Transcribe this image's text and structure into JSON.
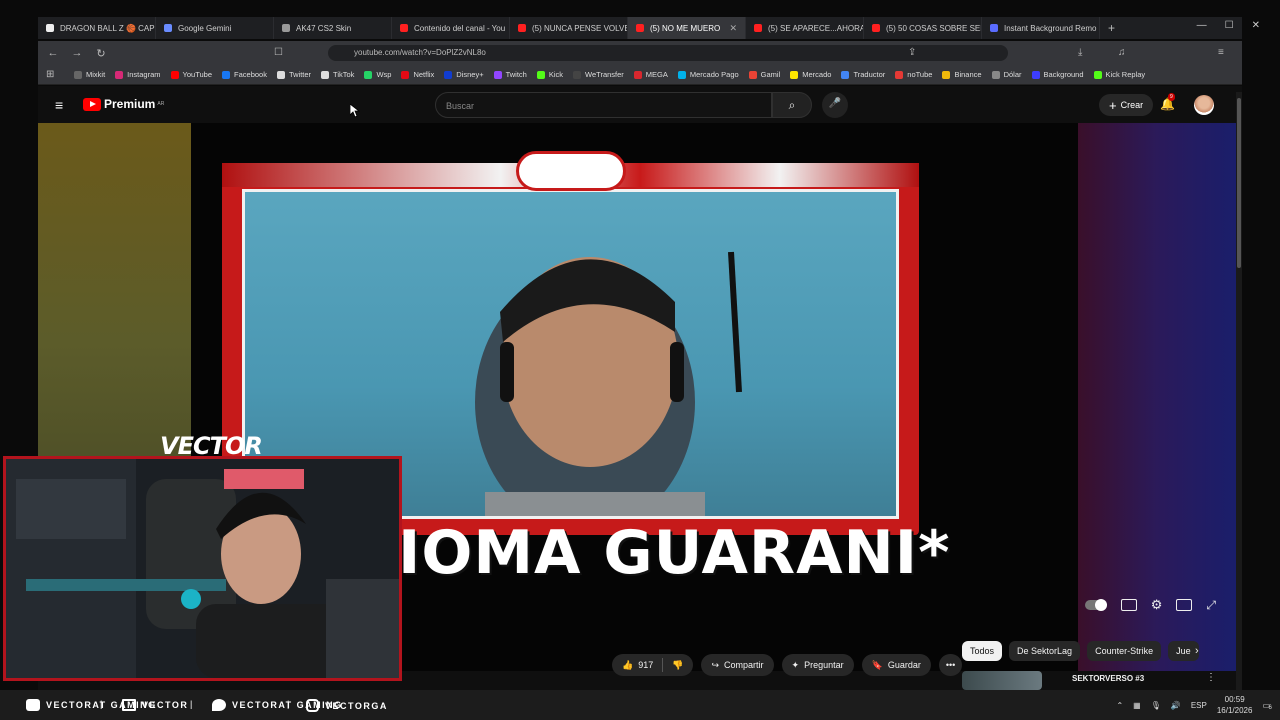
{
  "browser": {
    "tabs": [
      {
        "label": "DRAGON BALL Z 🏀 CAP",
        "color": "#eeeeee"
      },
      {
        "label": "Google Gemini",
        "color": "#6a8cff"
      },
      {
        "label": "AK47 CS2 Skin",
        "color": "#999999"
      },
      {
        "label": "Contenido del canal - You",
        "color": "#ff2020"
      },
      {
        "label": "(5) NUNCA PENSE VOLVE",
        "color": "#ff2020"
      },
      {
        "label": "(5) NO ME MUERO",
        "color": "#ff2020",
        "active": true
      },
      {
        "label": "(5) SE APARECE...AHORA!",
        "color": "#ff2020"
      },
      {
        "label": "(5) 50 COSAS SOBRE SEK",
        "color": "#ff2020"
      },
      {
        "label": "Instant Background Remo",
        "color": "#5a6cff"
      }
    ],
    "url": "youtube.com/watch?v=DoPlZ2vNL8o",
    "bookmarks": [
      {
        "label": "Mixkit",
        "color": "#666666"
      },
      {
        "label": "Instagram",
        "color": "#d62976"
      },
      {
        "label": "YouTube",
        "color": "#ff0000"
      },
      {
        "label": "Facebook",
        "color": "#1877f2"
      },
      {
        "label": "Twitter",
        "color": "#dddddd"
      },
      {
        "label": "TikTok",
        "color": "#dddddd"
      },
      {
        "label": "Wsp",
        "color": "#25d366"
      },
      {
        "label": "Netflix",
        "color": "#e50914"
      },
      {
        "label": "Disney+",
        "color": "#113ccf"
      },
      {
        "label": "Twitch",
        "color": "#9146ff"
      },
      {
        "label": "Kick",
        "color": "#53fc18"
      },
      {
        "label": "WeTransfer",
        "color": "#444444"
      },
      {
        "label": "MEGA",
        "color": "#d9272e"
      },
      {
        "label": "Mercado Pago",
        "color": "#00b1ea"
      },
      {
        "label": "Gamil",
        "color": "#ea4335"
      },
      {
        "label": "Mercado",
        "color": "#ffe600"
      },
      {
        "label": "Traductor",
        "color": "#4285f4"
      },
      {
        "label": "noTube",
        "color": "#e53935"
      },
      {
        "label": "Binance",
        "color": "#f0b90b"
      },
      {
        "label": "Dólar",
        "color": "#888888"
      },
      {
        "label": "Background",
        "color": "#3d3dff"
      },
      {
        "label": "Kick Replay",
        "color": "#53fc18"
      }
    ]
  },
  "youtube": {
    "logo_text": "Premium",
    "region": "AR",
    "search_placeholder": "Buscar",
    "create_label": "Crear",
    "notif_count": "9",
    "caption_text": "IOMA GUARANI*",
    "likes": "917",
    "share_label": "Compartir",
    "ask_label": "Preguntar",
    "save_label": "Guardar",
    "chips": [
      "Todos",
      "De SektorLag",
      "Counter-Strike",
      "Jue"
    ],
    "next_video_title": "SEKTORVERSO #3"
  },
  "stream_overlay": {
    "streamer_name": "VECTOR",
    "socials": [
      {
        "label": "VECTORAT GAMING",
        "icon": "youtube-icon"
      },
      {
        "label": "VECTOR",
        "icon": "twitch-icon"
      },
      {
        "label": "VECTORAT GAMING",
        "icon": "twitter-icon"
      },
      {
        "label": "VECTORGA",
        "icon": "instagram-icon"
      }
    ]
  },
  "taskbar": {
    "lang": "ESP",
    "time": "00:59",
    "date": "16/1/2026",
    "notif": "6"
  }
}
